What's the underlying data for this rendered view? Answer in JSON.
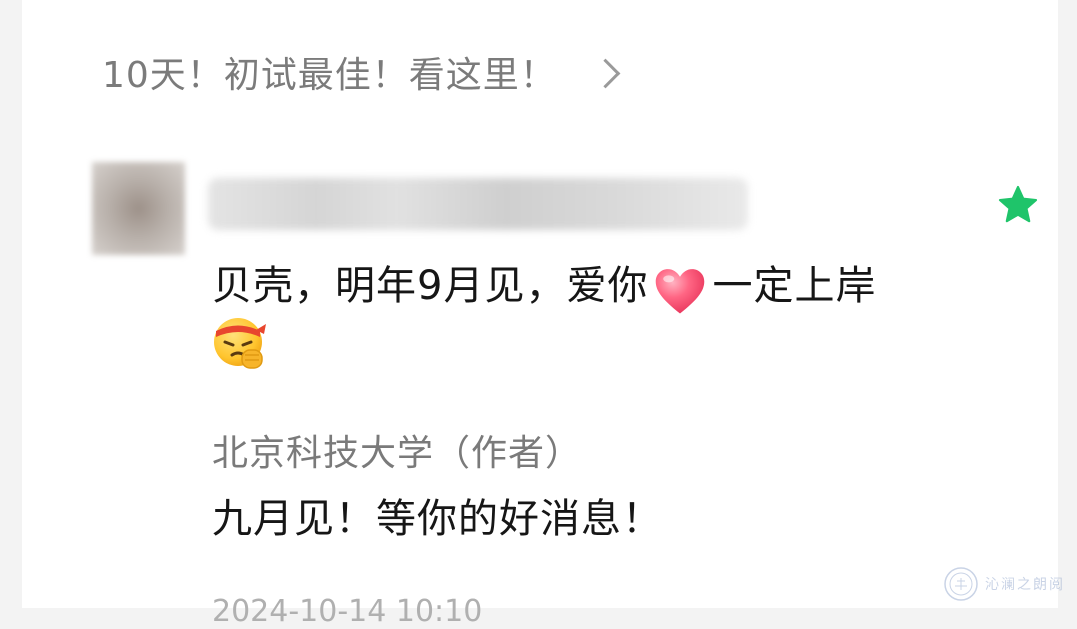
{
  "article_link": {
    "label": "10天！初试最佳！看这里！"
  },
  "comment": {
    "username_blurred": "",
    "text_part1": "贝壳，明年9月见，爱你",
    "text_part2": "一定上岸",
    "starred": true
  },
  "reply": {
    "author": "北京科技大学（作者）",
    "text": "九月见！等你的好消息！"
  },
  "timestamp_partial": "2024-10-14 10:10",
  "watermark": {
    "text": "沁澜之朗阅"
  },
  "colors": {
    "star": "#1fc46a",
    "heart": "#ff5a78",
    "secondary_text": "#7a7a7a",
    "primary_text": "#161616"
  },
  "icons": {
    "chevron": "chevron-right-icon",
    "star": "star-icon",
    "heart": "heart-emoji-icon",
    "face": "determined-face-emoji-icon"
  }
}
